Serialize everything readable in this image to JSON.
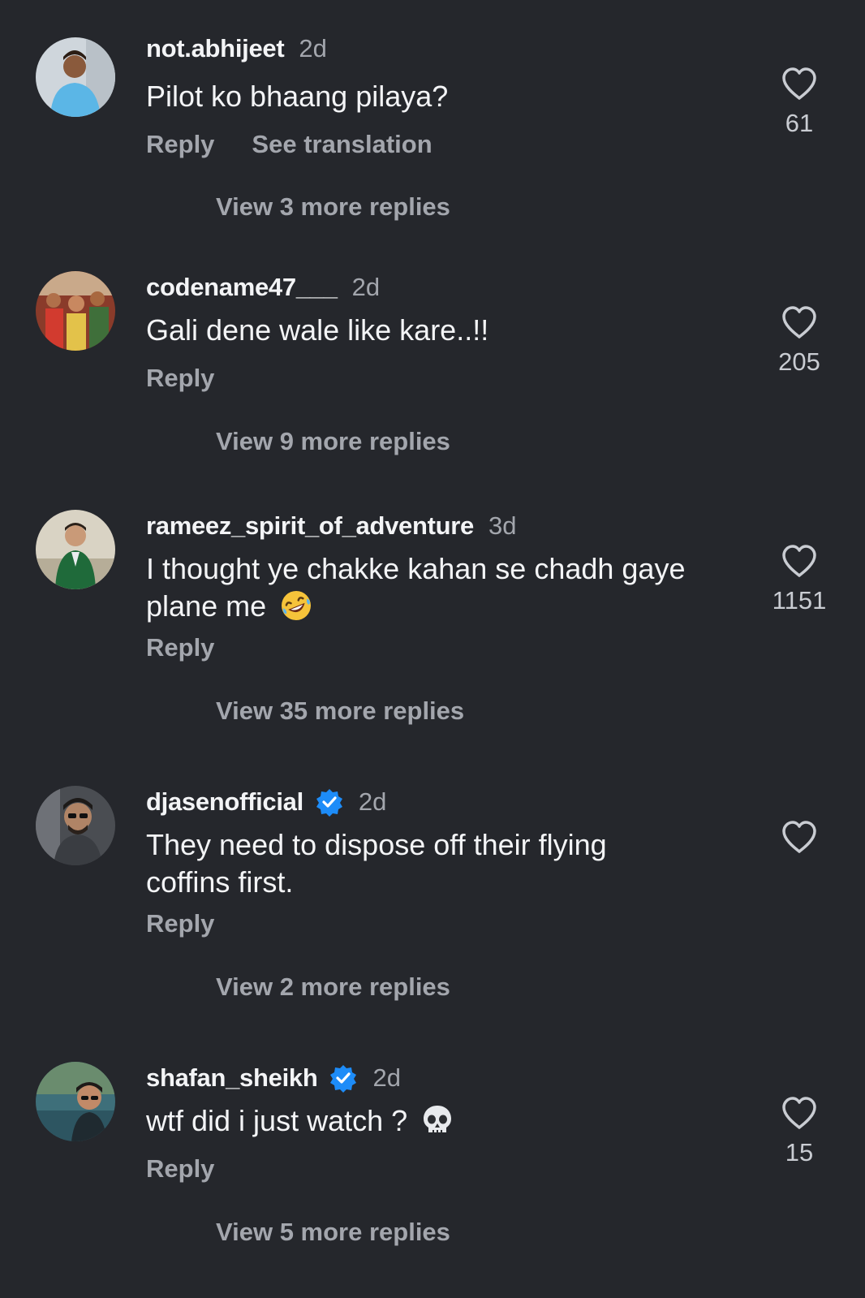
{
  "colors": {
    "background": "#25272c",
    "primary_text": "#f3f4f6",
    "secondary_text": "#a3a6ad",
    "verified_badge": "#1d8cf8"
  },
  "comments": [
    {
      "username": "not.abhijeet",
      "time": "2d",
      "text": "Pilot ko bhaang pilaya?",
      "reply_label": "Reply",
      "see_translation_label": "See translation",
      "likes": "61",
      "view_replies": "View 3 more replies",
      "avatar_icon": "avatar-photo"
    },
    {
      "username": "codename47___",
      "time": "2d",
      "text": "Gali dene wale like kare..!!",
      "reply_label": "Reply",
      "likes": "205",
      "view_replies": "View 9 more replies",
      "avatar_icon": "avatar-photo"
    },
    {
      "username": "rameez_spirit_of_adventure",
      "time": "3d",
      "text_line1": "I thought ye chakke kahan se chadh gaye",
      "text_line2": "plane me",
      "emoji_icon": "rolling-on-floor-laughing-emoji",
      "reply_label": "Reply",
      "likes": "1151",
      "view_replies": "View 35 more replies",
      "avatar_icon": "avatar-photo"
    },
    {
      "username": "djasenofficial",
      "verified": true,
      "time": "2d",
      "text_line1": "They need to dispose off their flying",
      "text_line2": "coffins first.",
      "reply_label": "Reply",
      "view_replies": "View 2 more replies",
      "avatar_icon": "avatar-photo"
    },
    {
      "username": "shafan_sheikh",
      "verified": true,
      "time": "2d",
      "text": "wtf did i just watch ?",
      "emoji_icon": "skull-emoji",
      "reply_label": "Reply",
      "likes": "15",
      "view_replies": "View 5 more replies",
      "avatar_icon": "avatar-photo"
    }
  ]
}
